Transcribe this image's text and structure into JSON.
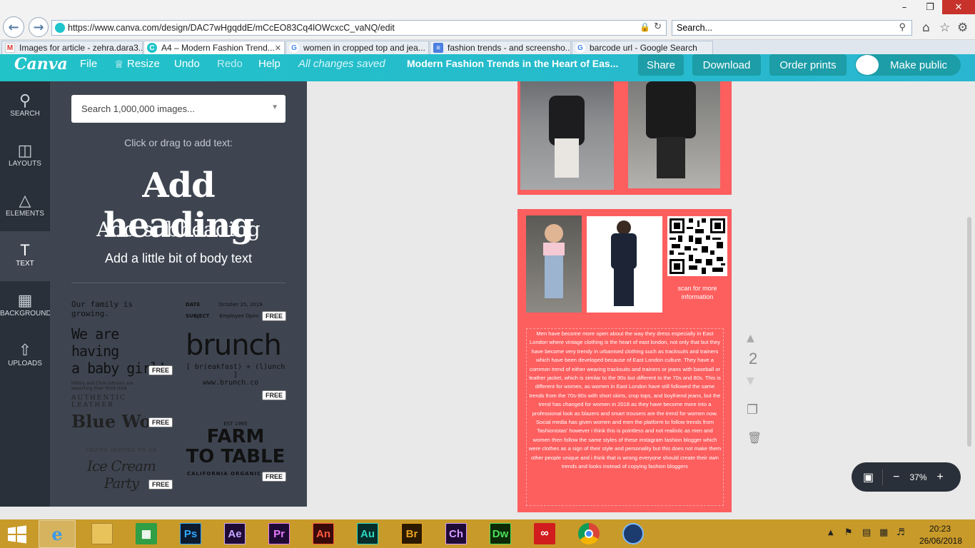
{
  "browser": {
    "url": "https://www.canva.com/design/DAC7wHgqddE/mCcEO83Cq4lOWcxcC_vaNQ/edit",
    "search_placeholder": "Search...",
    "tabs": [
      {
        "label": "Images for article - zehra.dara3...",
        "favicon": "gmail"
      },
      {
        "label": "A4 – Modern Fashion Trend...",
        "favicon": "canva"
      },
      {
        "label": "women in cropped top and jea...",
        "favicon": "google"
      },
      {
        "label": "fashion trends - and screensho...",
        "favicon": "docs"
      },
      {
        "label": "barcode url - Google Search",
        "favicon": "google"
      }
    ]
  },
  "toolbar": {
    "logo": "Canva",
    "file": "File",
    "resize": "Resize",
    "undo": "Undo",
    "redo": "Redo",
    "help": "Help",
    "status": "All changes saved",
    "title": "Modern Fashion Trends in the Heart of Eas...",
    "share": "Share",
    "download": "Download",
    "order_prints": "Order prints",
    "make_public": "Make public"
  },
  "rail": [
    {
      "label": "SEARCH",
      "icon": "search-icon"
    },
    {
      "label": "LAYOUTS",
      "icon": "layouts-icon"
    },
    {
      "label": "ELEMENTS",
      "icon": "elements-icon"
    },
    {
      "label": "TEXT",
      "icon": "text-icon"
    },
    {
      "label": "BACKGROUND",
      "icon": "background-icon"
    },
    {
      "label": "UPLOADS",
      "icon": "upload-icon"
    }
  ],
  "panel": {
    "search_placeholder": "Search 1,000,000 images...",
    "hint": "Click or drag to add text:",
    "heading": "Add heading",
    "subheading": "Add subheading",
    "body": "Add a little bit of body text",
    "free": "FREE",
    "templates": {
      "family_line": "Our family is growing.",
      "baby_line1": "We are having",
      "baby_line2": "a baby girl!",
      "baby_small": "Hillary and Chris Johnson are expecting their third child",
      "date_label": "DATE",
      "date_value": "October 25, 2019",
      "subject_label": "SUBJECT",
      "subject_value": "Employee Opini",
      "brunch": "brunch",
      "brunch_sub": "[ br(eakfast) + (l)unch ]",
      "brunch_url": "www.brunch.co",
      "leather_small": "AUTHENTIC LEATHER",
      "leather_big": "Blue Wo",
      "est": "EST 1995",
      "farm1": "FARM",
      "farm2": "TO TABLE",
      "farm_sub": "CALIFORNIA ORGANIC F",
      "invited": "YOU'RE INVITED TO AN",
      "icecream": "Ice Cream Party"
    }
  },
  "canvas": {
    "qr_caption": "scan for more information",
    "body_text": "Men have become more open about the way they dress especially in East London where vintage clothing is the heart of east london, not only that but they have become very trendy in urbanised clothing such as tracksuits and trainers which have been developed because of East London culture. They have a common trend of either wearing tracksuits and trainers or jeans with baseball or leather jacket, which is similar to the 90s but different to the 70s and 80s. This is different for women, as women in East London have still followed the same trends from the 70s-90s with short skirts, crop tops, and boyfriend jeans, but the trend has changed for women in 2018 as they have become more into a professional look as blazers and smart trousers are the trend for women now. Social media has given women and men the platform to follow trends from 'fashionistas' however i think this is pointless and not realistic as men and women then follow the same styles of these instagram fashion blogger which were clothes as a sign of their style and personality but this does not make them other people unique and i think that is wrong everyone should create their own trends and looks instead of copying fashion bloggers",
    "page_number": "2",
    "zoom": "37%"
  },
  "taskbar": {
    "apps": [
      "Ps",
      "Ae",
      "Pr",
      "An",
      "Au",
      "Br",
      "Ch",
      "Dw"
    ],
    "time": "20:23",
    "date": "26/06/2018"
  }
}
